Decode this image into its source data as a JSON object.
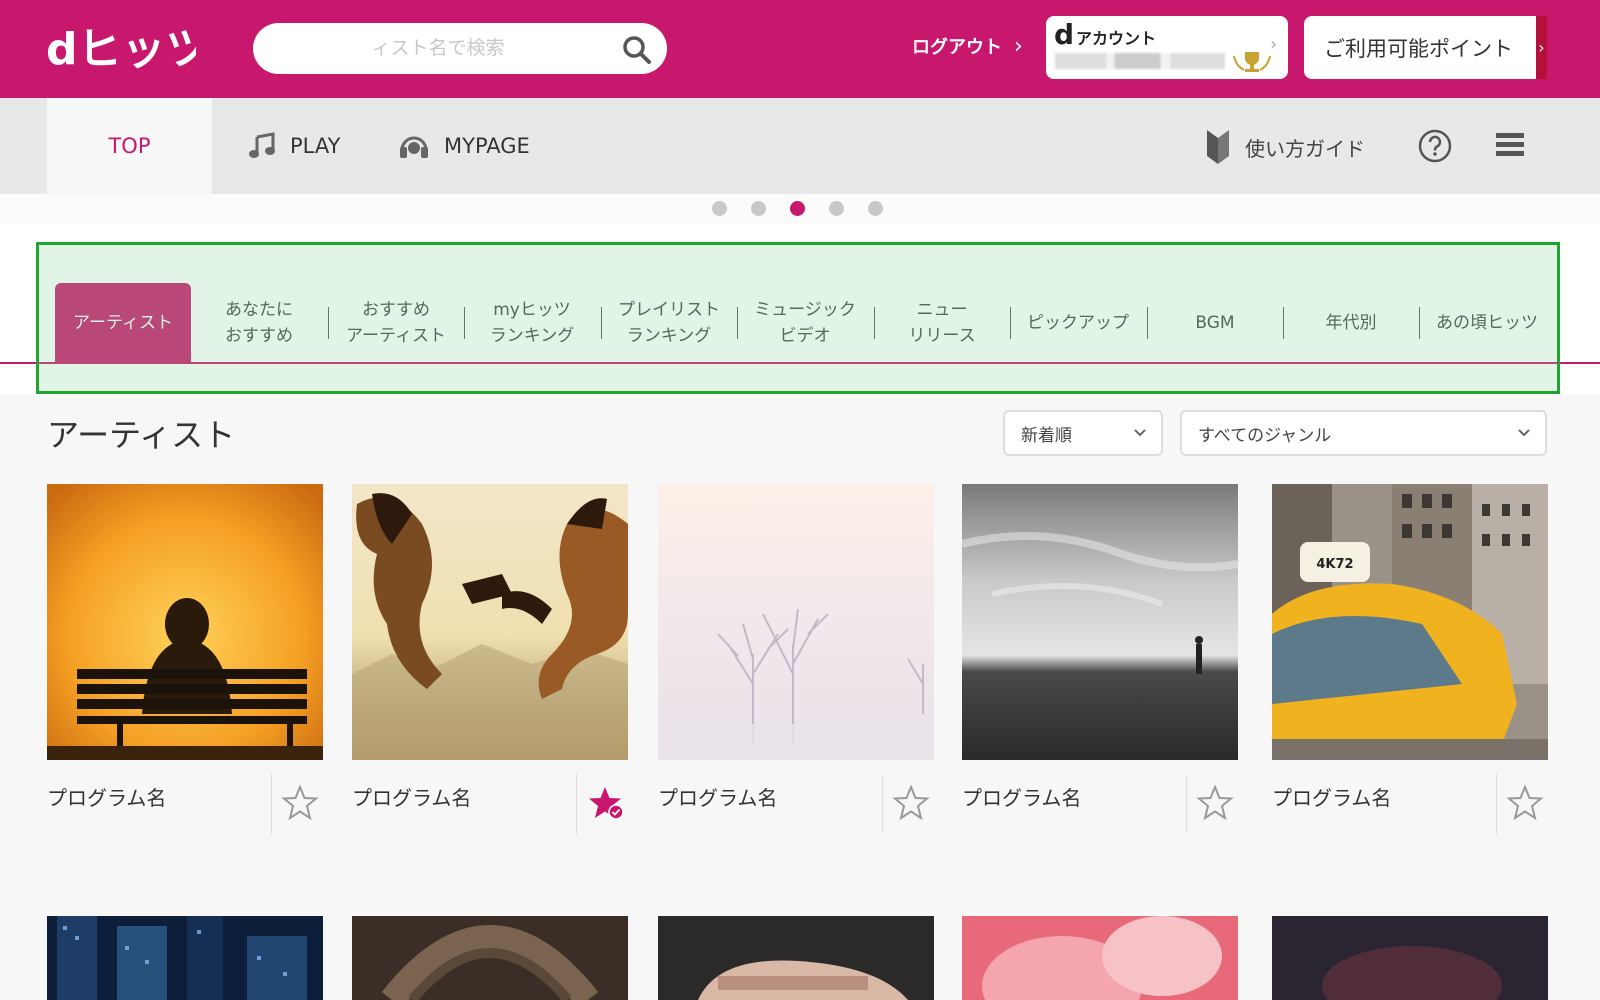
{
  "header": {
    "logo_text": "dヒッツ",
    "search_placeholder": "ィスト名で検索",
    "logout_label": "ログアウト",
    "logout_chevron": "›",
    "daccount_d": "d",
    "daccount_label": "アカウント",
    "daccount_chevron": "›",
    "points_label": "ご利用可能ポイント",
    "points_chevron": "›"
  },
  "nav": {
    "top_label": "TOP",
    "play_label": "PLAY",
    "mypage_label": "MYPAGE",
    "guide_label": "使い方ガイド"
  },
  "carousel": {
    "count": 5,
    "active_index": 2
  },
  "categories": [
    {
      "line1": "アーティスト",
      "line2": ""
    },
    {
      "line1": "あなたに",
      "line2": "おすすめ"
    },
    {
      "line1": "おすすめ",
      "line2": "アーティスト"
    },
    {
      "line1": "myヒッツ",
      "line2": "ランキング"
    },
    {
      "line1": "プレイリスト",
      "line2": "ランキング"
    },
    {
      "line1": "ミュージック",
      "line2": "ビデオ"
    },
    {
      "line1": "ニュー",
      "line2": "リリース"
    },
    {
      "line1": "ピックアップ",
      "line2": ""
    },
    {
      "line1": "BGM",
      "line2": ""
    },
    {
      "line1": "年代別",
      "line2": ""
    },
    {
      "line1": "あの頃ヒッツ",
      "line2": ""
    }
  ],
  "content": {
    "title": "アーティスト",
    "sort_value": "新着順",
    "genre_value": "すべてのジャンル",
    "cards": [
      {
        "name": "プログラム名",
        "favorited": false,
        "image": "bench-sunset"
      },
      {
        "name": "プログラム名",
        "favorited": true,
        "image": "horses"
      },
      {
        "name": "プログラム名",
        "favorited": false,
        "image": "foggy-trees"
      },
      {
        "name": "プログラム名",
        "favorited": false,
        "image": "field-bw"
      },
      {
        "name": "プログラム名",
        "favorited": false,
        "image": "taxi"
      }
    ],
    "row2_images": [
      "city-night",
      "stone-arch",
      "vintage-car",
      "pink-rose",
      "dark-flower"
    ]
  },
  "colors": {
    "brand": "#c8186e",
    "highlight_border": "#22a22e",
    "nav_bg": "#e8e8e8"
  }
}
